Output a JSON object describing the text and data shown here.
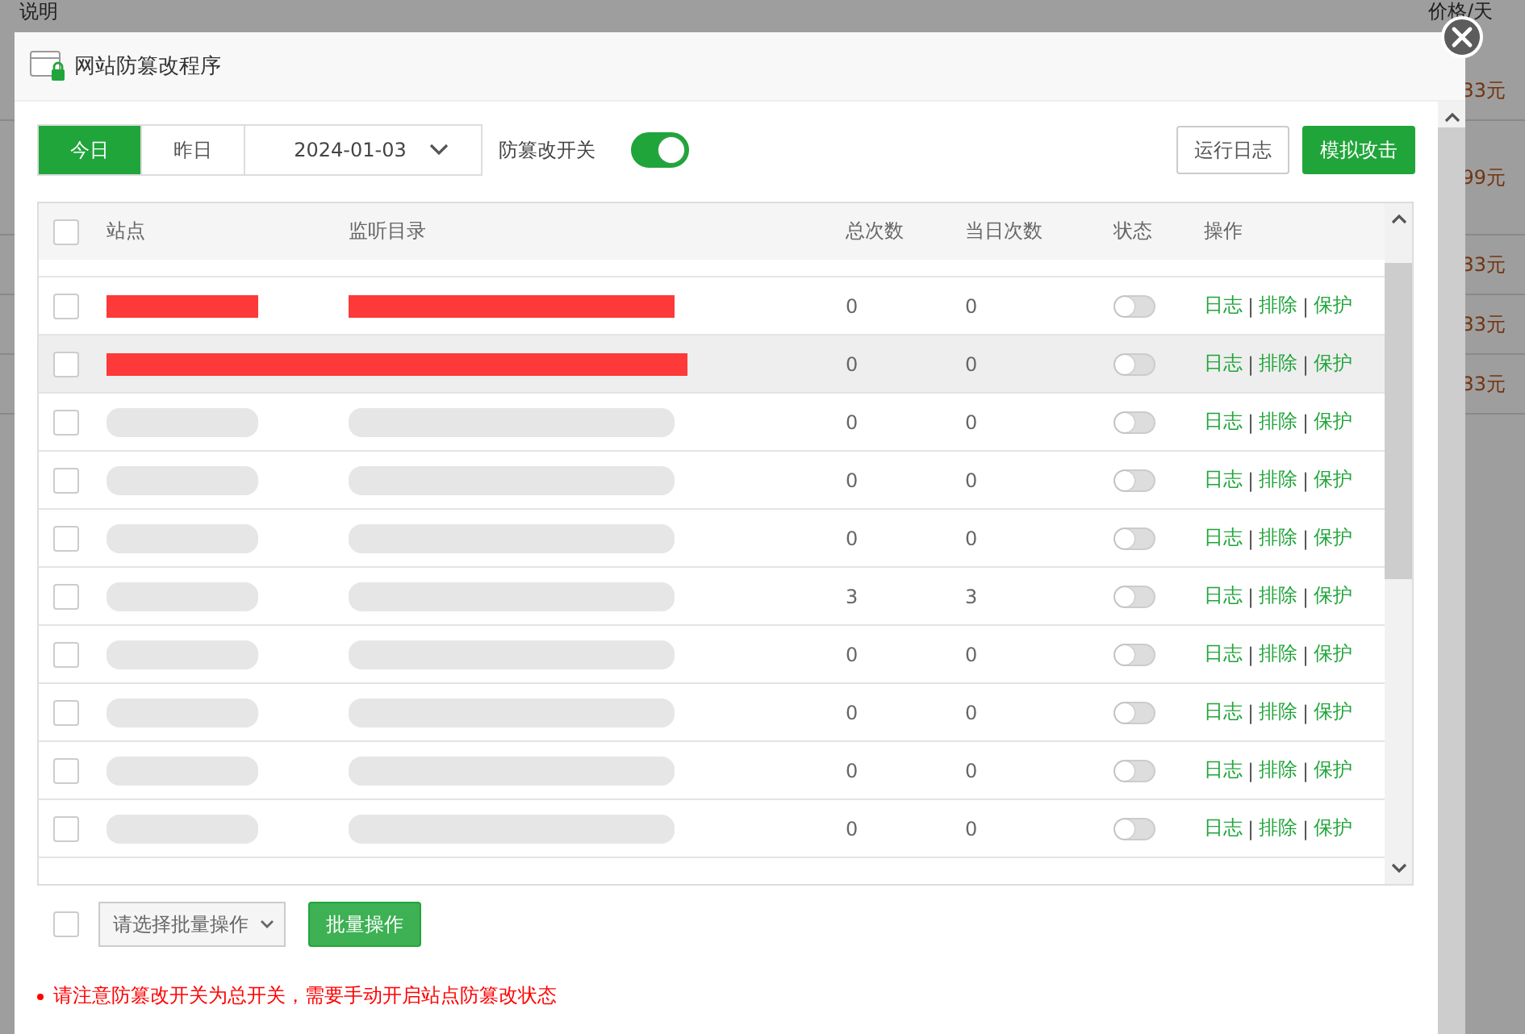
{
  "background_page": {
    "columns": [
      "说明",
      "价格/天"
    ],
    "prices": [
      "33元",
      "99元",
      "33元",
      "33元",
      "33元"
    ]
  },
  "dialog": {
    "title": "网站防篡改程序",
    "date_tabs": [
      {
        "label": "今日",
        "selected": true
      },
      {
        "label": "昨日",
        "selected": false
      }
    ],
    "date_picker": {
      "value": "2024-01-03"
    },
    "master_switch": {
      "label": "防篡改开关",
      "on": true
    },
    "buttons": [
      {
        "label": "运行日志",
        "kind": "plain"
      },
      {
        "label": "模拟攻击",
        "kind": "primary"
      }
    ],
    "table": {
      "columns": [
        "站点",
        "监听目录",
        "总次数",
        "当日次数",
        "状态",
        "操作"
      ],
      "action_separator": "|",
      "header_checked": false,
      "rows": [
        {
          "kind": "redacted",
          "checked": false,
          "total": "0",
          "today": "0",
          "on": false,
          "hovered": false,
          "actions": [
            "日志",
            "排除",
            "保护"
          ]
        },
        {
          "kind": "redacted",
          "checked": false,
          "total": "0",
          "today": "0",
          "on": false,
          "hovered": true,
          "actions": [
            "日志",
            "排除",
            "保护"
          ]
        },
        {
          "kind": "blurred",
          "checked": false,
          "total": "0",
          "today": "0",
          "on": false,
          "hovered": false,
          "actions": [
            "日志",
            "排除",
            "保护"
          ]
        },
        {
          "kind": "blurred",
          "checked": false,
          "total": "0",
          "today": "0",
          "on": false,
          "hovered": false,
          "actions": [
            "日志",
            "排除",
            "保护"
          ]
        },
        {
          "kind": "blurred",
          "checked": false,
          "total": "0",
          "today": "0",
          "on": false,
          "hovered": false,
          "actions": [
            "日志",
            "排除",
            "保护"
          ]
        },
        {
          "kind": "blurred",
          "checked": false,
          "total": "3",
          "today": "3",
          "on": false,
          "hovered": false,
          "actions": [
            "日志",
            "排除",
            "保护"
          ]
        },
        {
          "kind": "blurred",
          "checked": false,
          "total": "0",
          "today": "0",
          "on": false,
          "hovered": false,
          "actions": [
            "日志",
            "排除",
            "保护"
          ]
        },
        {
          "kind": "blurred",
          "checked": false,
          "total": "0",
          "today": "0",
          "on": false,
          "hovered": false,
          "actions": [
            "日志",
            "排除",
            "保护"
          ]
        },
        {
          "kind": "blurred",
          "checked": false,
          "total": "0",
          "today": "0",
          "on": false,
          "hovered": false,
          "actions": [
            "日志",
            "排除",
            "保护"
          ]
        },
        {
          "kind": "blurred",
          "checked": false,
          "total": "0",
          "today": "0",
          "on": false,
          "hovered": false,
          "actions": [
            "日志",
            "排除",
            "保护"
          ]
        }
      ]
    },
    "batch": {
      "checked": false,
      "select_placeholder": "请选择批量操作",
      "button": "批量操作"
    },
    "notice": "请注意防篡改开关为总开关，需要手动开启站点防篡改状态"
  }
}
